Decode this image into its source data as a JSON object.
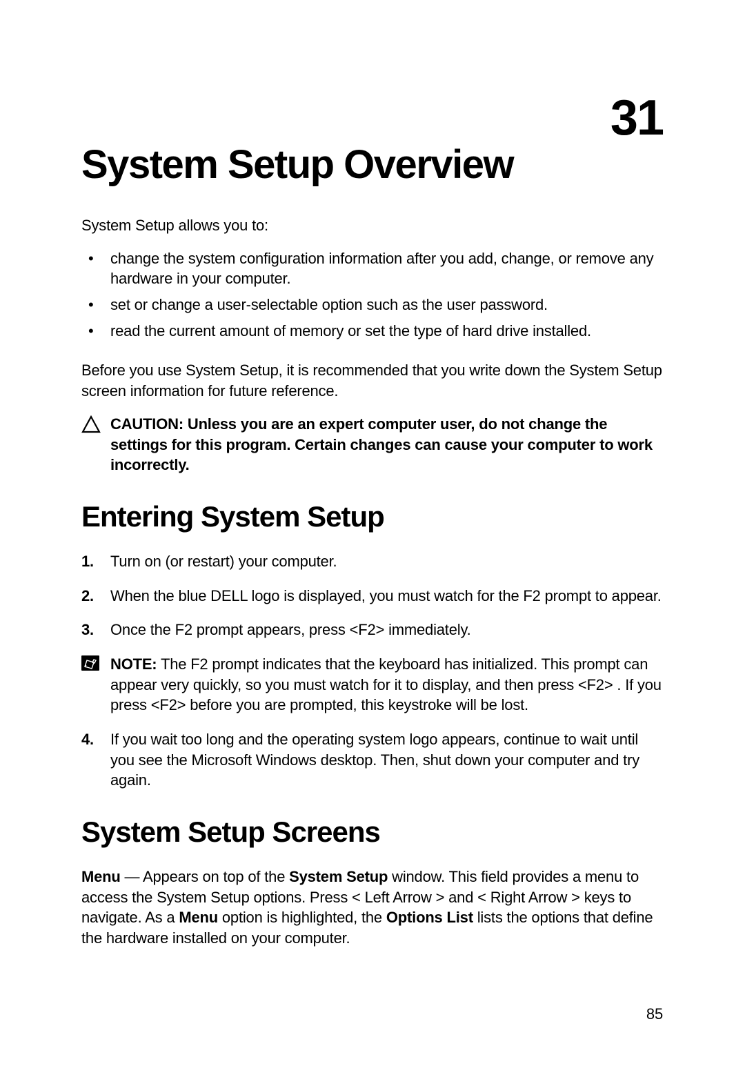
{
  "chapter_number": "31",
  "title": "System Setup Overview",
  "intro": "System Setup allows you to:",
  "bullets": [
    "change the system configuration information after you add, change, or remove any hardware in your computer.",
    "set or change a user-selectable option such as the user password.",
    "read the current amount of memory or set the type of hard drive installed."
  ],
  "pre_caution": "Before you use System Setup, it is recommended that you write down the System Setup screen information for future reference.",
  "caution": {
    "label": "CAUTION:",
    "text": "Unless you are an expert computer user, do not change the settings for this program. Certain changes can cause your computer to work incorrectly."
  },
  "section_entering": "Entering System Setup",
  "steps": [
    "Turn on (or restart) your computer.",
    "When the blue DELL logo is displayed, you must watch for the F2 prompt to appear.",
    "Once the F2 prompt appears, press <F2> immediately."
  ],
  "note": {
    "label": "NOTE:",
    "text": "The F2 prompt indicates that the keyboard has initialized. This prompt can appear very quickly, so you must watch for it to display, and then press <F2> . If you press <F2> before you are prompted, this keystroke will be lost."
  },
  "step4": "If you wait too long and the operating system logo appears, continue to wait until you see the Microsoft Windows desktop. Then, shut down your computer and try again.",
  "section_screens": "System Setup Screens",
  "screens_para": {
    "b1": "Menu",
    "t1": " — Appears on top of the ",
    "b2": "System Setup",
    "t2": " window. This field provides a menu to access the System Setup options. Press < Left Arrow > and < Right Arrow > keys to navigate. As a ",
    "b3": "Menu",
    "t3": " option is highlighted, the ",
    "b4": "Options List",
    "t4": " lists the options that define the hardware installed on your computer."
  },
  "page_number": "85"
}
